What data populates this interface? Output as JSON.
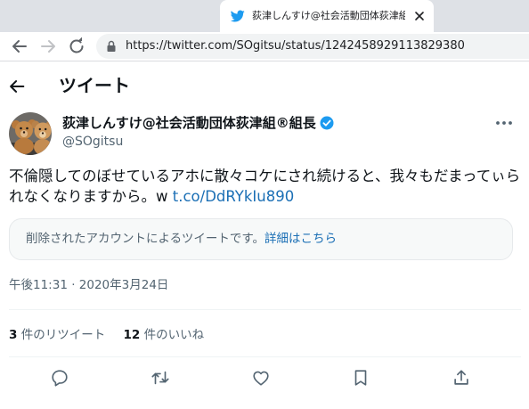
{
  "browser": {
    "tab_title": "荻津しんすけ@社会活動団体荻津組",
    "url": "https://twitter.com/SOgitsu/status/1242458929113829380"
  },
  "header": {
    "title": "ツイート"
  },
  "author": {
    "display_name": "荻津しんすけ@社会活動団体荻津組®組長",
    "handle": "@SOgitsu"
  },
  "tweet": {
    "text": "不倫隠してのぼせているアホに散々コケにされ続けると、我々もだまってぃられなくなりますから。w ",
    "link": "t.co/DdRYkIu890",
    "timestamp": "午後11:31 · 2020年3月24日"
  },
  "deleted_card": {
    "text": "削除されたアカウントによるツイートです。",
    "link": "詳細はこちら"
  },
  "stats": {
    "retweets_count": "3",
    "retweets_label": " 件のリツイート",
    "likes_count": "12",
    "likes_label": " 件のいいね"
  },
  "colors": {
    "link": "#1b6fb5",
    "verified": "#1d9bf0",
    "secondary_text": "#536471",
    "primary_text": "#0f1419"
  },
  "icons": {
    "tab": "twitter-bird-icon",
    "actions": [
      "reply-icon",
      "retweet-icon",
      "like-icon",
      "bookmark-icon",
      "share-icon"
    ]
  }
}
